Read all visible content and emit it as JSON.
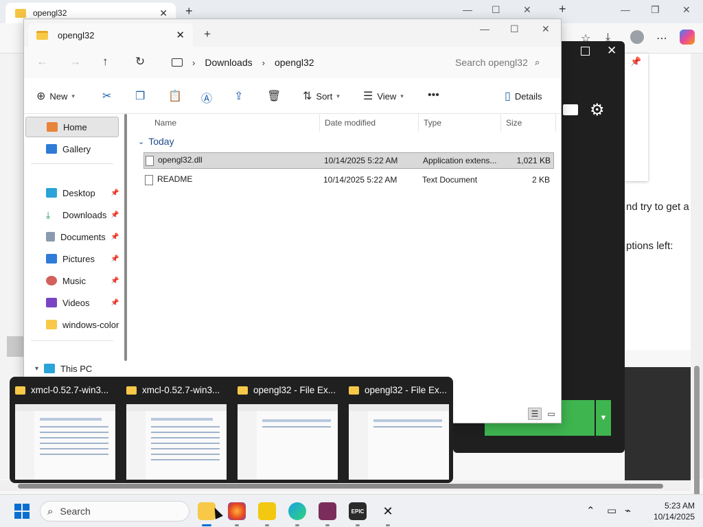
{
  "background_browser": {
    "tab_title": "opengl32",
    "partial_texts": [
      "nd try to get a",
      "ptions left:"
    ]
  },
  "explorer": {
    "tab_title": "opengl32",
    "breadcrumb": [
      "Downloads",
      "opengl32"
    ],
    "search_placeholder": "Search opengl32",
    "toolbar": {
      "new": "New",
      "sort": "Sort",
      "view": "View",
      "details": "Details"
    },
    "nav": {
      "home": "Home",
      "gallery": "Gallery",
      "desktop": "Desktop",
      "downloads": "Downloads",
      "documents": "Documents",
      "pictures": "Pictures",
      "music": "Music",
      "videos": "Videos",
      "folder": "windows-color-",
      "this_pc": "This PC"
    },
    "columns": {
      "name": "Name",
      "date": "Date modified",
      "type": "Type",
      "size": "Size"
    },
    "group": "Today",
    "files": [
      {
        "name": "opengl32.dll",
        "date": "10/14/2025 5:22 AM",
        "type": "Application extens...",
        "size": "1,021 KB"
      },
      {
        "name": "README",
        "date": "10/14/2025 5:22 AM",
        "type": "Text Document",
        "size": "2 KB"
      }
    ]
  },
  "thumbnails": [
    {
      "title": "xmcl-0.52.7-win3..."
    },
    {
      "title": "xmcl-0.52.7-win3..."
    },
    {
      "title": "opengl32 - File Ex..."
    },
    {
      "title": "opengl32 - File Ex..."
    }
  ],
  "taskbar": {
    "search_label": "Search",
    "apps": [
      "File Explorer",
      "Firefox",
      "Power BI",
      "Edge",
      "Rockstar",
      "Epic Games",
      "X"
    ],
    "time": "5:23 AM",
    "date": "10/14/2025"
  },
  "colors": {
    "accent": "#0a6fd1",
    "folder": "#f8c948",
    "green_button": "#3fb550",
    "thumb_bg": "#202020"
  }
}
